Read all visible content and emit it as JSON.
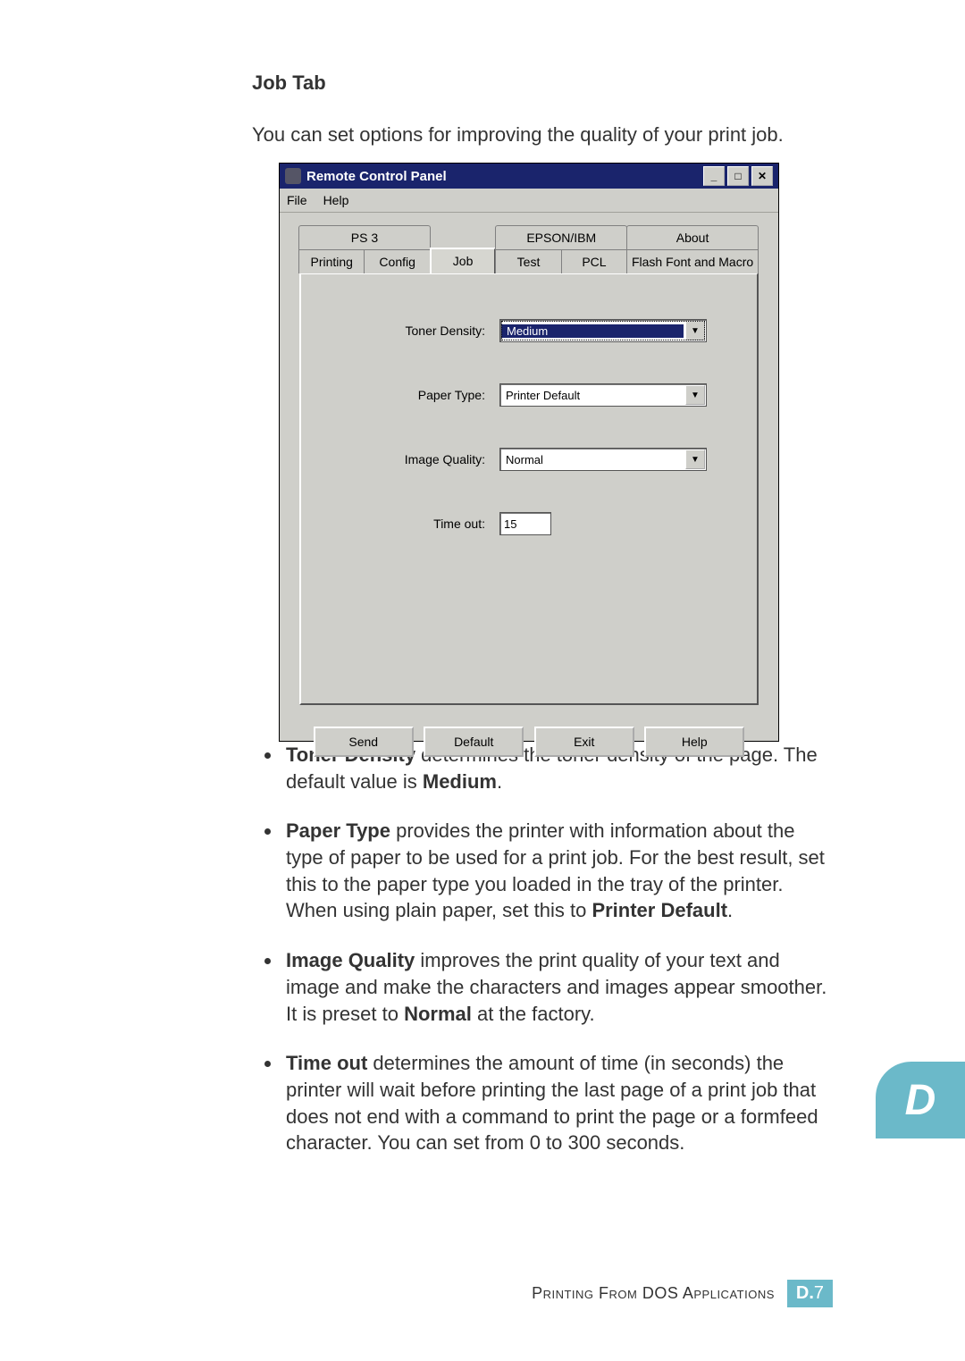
{
  "heading": "Job Tab",
  "intro": "You can set options for improving the quality of your print job.",
  "window": {
    "title": "Remote Control Panel",
    "menu": {
      "file": "File",
      "help": "Help"
    },
    "tabs_top": [
      "PS 3",
      "",
      "EPSON/IBM",
      "",
      "About"
    ],
    "tabs_bottom": [
      "Printing",
      "Config",
      "Job",
      "Test",
      "PCL",
      "Flash Font and Macro"
    ],
    "active_tab": "Job",
    "fields": {
      "toner_density": {
        "label": "Toner Density:",
        "value": "Medium"
      },
      "paper_type": {
        "label": "Paper Type:",
        "value": "Printer Default"
      },
      "image_quality": {
        "label": "Image Quality:",
        "value": "Normal"
      },
      "time_out": {
        "label": "Time out:",
        "value": "15"
      }
    },
    "buttons": {
      "send": "Send",
      "default": "Default",
      "exit": "Exit",
      "help": "Help"
    }
  },
  "bullets": [
    {
      "b": "Toner Density",
      "rest": " determines the toner density of the page. The default value is ",
      "b2": "Medium",
      "rest2": "."
    },
    {
      "b": "Paper Type",
      "rest": " provides the printer with information about the type of paper to be used for a print job. For the best result, set this to the paper type you loaded in the tray of the printer. When using plain paper, set this to ",
      "b2": "Printer Default",
      "rest2": "."
    },
    {
      "b": "Image Quality",
      "rest": " improves the print quality of your text and image and make the characters and images appear smoother. It is preset to ",
      "b2": "Normal",
      "rest2": " at the factory."
    },
    {
      "b": "Time out",
      "rest": " determines the amount of time (in seconds) the printer will wait before printing the last page of a print job that does not end with a command to print the page or a formfeed character. You can set from 0 to 300 seconds.",
      "b2": "",
      "rest2": ""
    }
  ],
  "sidetab": "D",
  "footer": {
    "caption": "Printing From DOS Applications",
    "prefix": "D.",
    "num": "7"
  }
}
